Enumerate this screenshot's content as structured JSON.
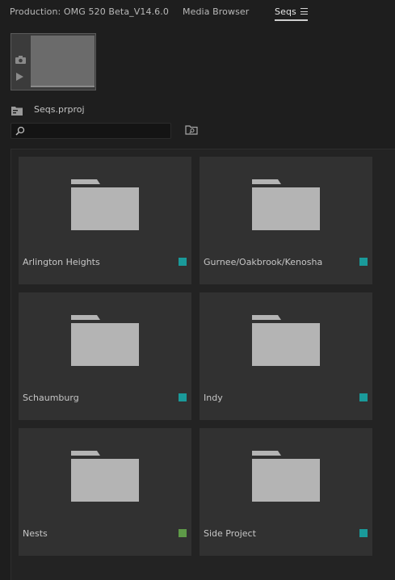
{
  "tabs": [
    {
      "label": "Production: OMG 520 Beta_V14.6.0",
      "active": false
    },
    {
      "label": "Media Browser",
      "active": false
    },
    {
      "label": "Seqs",
      "active": true
    }
  ],
  "thumbnail": {
    "camera_icon": "camera-icon",
    "play_icon": "play-icon"
  },
  "project": {
    "name": "Seqs.prproj",
    "icon": "project-bin-icon"
  },
  "search": {
    "value": "",
    "placeholder": "",
    "icon": "search-icon",
    "find_icon": "find-in-folder-icon"
  },
  "bins": [
    {
      "label": "Arlington Heights",
      "label_color": "#1a9a9a"
    },
    {
      "label": "Gurnee/Oakbrook/Kenosha",
      "label_color": "#1a9a9a"
    },
    {
      "label": "Schaumburg",
      "label_color": "#1a9a9a"
    },
    {
      "label": "Indy",
      "label_color": "#1a9a9a"
    },
    {
      "label": "Nests",
      "label_color": "#5e9a48"
    },
    {
      "label": "Side Project",
      "label_color": "#1a9a9a"
    }
  ],
  "colors": {
    "background": "#1e1e1e",
    "tile": "#313131",
    "folder": "#b4b4b4",
    "teal_label": "#1a9a9a",
    "green_label": "#5e9a48"
  }
}
